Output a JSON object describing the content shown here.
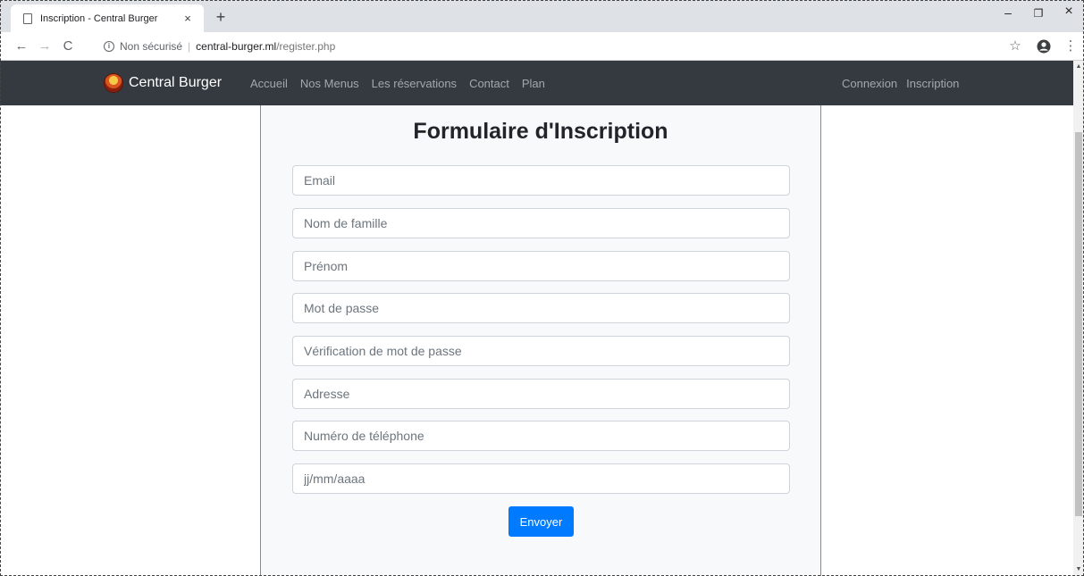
{
  "browser": {
    "tab_title": "Inscription - Central Burger",
    "tab_close": "×",
    "new_tab": "+",
    "security_text": "Non sécurisé",
    "url_separator": "|",
    "url_host": "central-burger.ml",
    "url_path": "/register.php",
    "window_minimize": "–",
    "window_restore": "❐",
    "window_close": "×"
  },
  "site": {
    "brand": "Central Burger",
    "nav_links": [
      "Accueil",
      "Nos Menus",
      "Les réservations",
      "Contact",
      "Plan"
    ],
    "nav_right": [
      "Connexion",
      "Inscription"
    ]
  },
  "form": {
    "title": "Formulaire d'Inscription",
    "fields": [
      {
        "placeholder": "Email"
      },
      {
        "placeholder": "Nom de famille"
      },
      {
        "placeholder": "Prénom"
      },
      {
        "placeholder": "Mot de passe"
      },
      {
        "placeholder": "Vérification de mot de passe"
      },
      {
        "placeholder": "Adresse"
      },
      {
        "placeholder": "Numéro de téléphone"
      },
      {
        "placeholder": "jj/mm/aaaa"
      }
    ],
    "submit_label": "Envoyer"
  },
  "colors": {
    "navbar_bg": "#343a40",
    "primary": "#007bff",
    "card_bg": "#f8f9fa"
  }
}
